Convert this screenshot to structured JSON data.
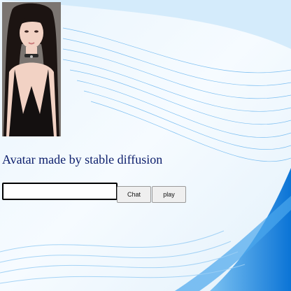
{
  "avatar": {
    "alt": "AI generated avatar portrait"
  },
  "caption": "Avatar made by stable diffusion",
  "chat": {
    "input_value": "",
    "placeholder": ""
  },
  "buttons": {
    "chat_label": "Chat",
    "play_label": "play"
  },
  "colors": {
    "caption": "#0b1d6b",
    "wave_blue": "#1e88e5",
    "bg_light": "#e6f3fc"
  }
}
